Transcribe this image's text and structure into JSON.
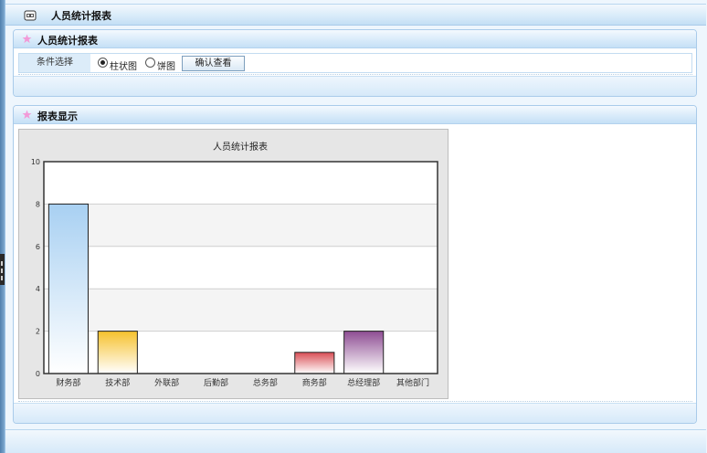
{
  "header": {
    "title": "人员统计报表",
    "icon": "report-icon"
  },
  "condition_panel": {
    "title": "人员统计报表",
    "filter_label": "条件选择",
    "options": [
      {
        "label": "柱状图",
        "checked": true
      },
      {
        "label": "饼图",
        "checked": false
      }
    ],
    "confirm_label": "确认查看"
  },
  "report_panel": {
    "title": "报表显示"
  },
  "chart_data": {
    "type": "bar",
    "title": "人员统计报表",
    "categories": [
      "财务部",
      "技术部",
      "外联部",
      "后勤部",
      "总务部",
      "商务部",
      "总经理部",
      "其他部门"
    ],
    "values": [
      8,
      2,
      0,
      0,
      0,
      1,
      2,
      0
    ],
    "bar_colors": [
      "#a8d0f2",
      "#f6c12c",
      null,
      null,
      null,
      "#d94e55",
      "#8e4d93",
      null
    ],
    "ylim": [
      0,
      10
    ],
    "yticks": [
      0,
      2,
      4,
      6,
      8,
      10
    ],
    "grid": true,
    "legend": "none"
  }
}
